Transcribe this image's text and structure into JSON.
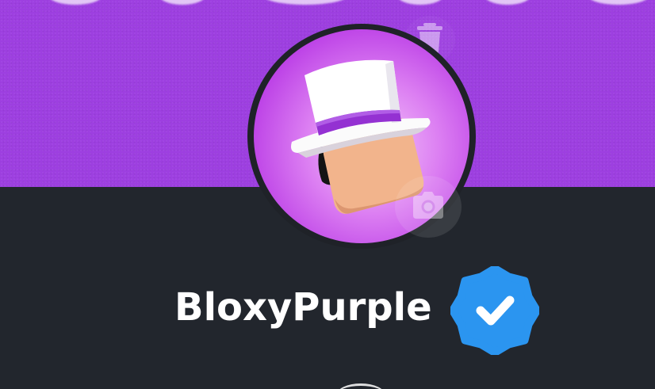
{
  "profile": {
    "username": "BloxyPurple",
    "verified": true
  },
  "icons": {
    "delete_banner": "trash-icon",
    "change_avatar": "camera-icon",
    "verified": "verified-badge-icon"
  },
  "colors": {
    "banner": "#9d3fe0",
    "background": "#22262d",
    "verified_badge": "#2b95f0",
    "text": "#ffffff"
  }
}
